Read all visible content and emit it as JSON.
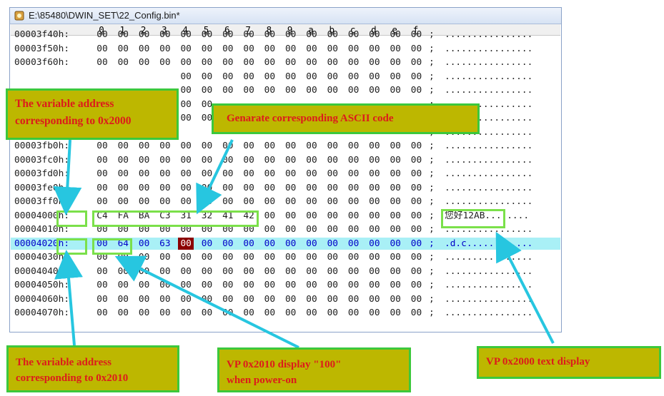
{
  "window": {
    "title": "E:\\85480\\DWIN_SET\\22_Config.bin*",
    "column_headers": [
      "0",
      "1",
      "2",
      "3",
      "4",
      "5",
      "6",
      "7",
      "8",
      "9",
      "a",
      "b",
      "c",
      "d",
      "e",
      "f"
    ]
  },
  "rows": [
    {
      "addr": "00003f40h:",
      "bytes": [
        "00",
        "00",
        "00",
        "00",
        "00",
        "00",
        "00",
        "00",
        "00",
        "00",
        "00",
        "00",
        "00",
        "00",
        "00",
        "00"
      ],
      "ascii": "................"
    },
    {
      "addr": "00003f50h:",
      "bytes": [
        "00",
        "00",
        "00",
        "00",
        "00",
        "00",
        "00",
        "00",
        "00",
        "00",
        "00",
        "00",
        "00",
        "00",
        "00",
        "00"
      ],
      "ascii": "................"
    },
    {
      "addr": "00003f60h:",
      "bytes": [
        "00",
        "00",
        "00",
        "00",
        "00",
        "00",
        "00",
        "00",
        "00",
        "00",
        "00",
        "00",
        "00",
        "00",
        "00",
        "00"
      ],
      "ascii": "................"
    },
    {
      "addr": "",
      "bytes": [
        "",
        "",
        "",
        "",
        "00",
        "00",
        "00",
        "00",
        "00",
        "00",
        "00",
        "00",
        "00",
        "00",
        "00",
        "00"
      ],
      "ascii": "................"
    },
    {
      "addr": "",
      "bytes": [
        "",
        "",
        "",
        "",
        "00",
        "00",
        "00",
        "00",
        "00",
        "00",
        "00",
        "00",
        "00",
        "00",
        "00",
        "00"
      ],
      "ascii": "................"
    },
    {
      "addr": "",
      "bytes": [
        "",
        "",
        "",
        "",
        "00",
        "00",
        "",
        "",
        "",
        "",
        "",
        "",
        "",
        "",
        "",
        ""
      ],
      "ascii": "................"
    },
    {
      "addr": "",
      "bytes": [
        "",
        "",
        "",
        "",
        "00",
        "00",
        "",
        "",
        "",
        "",
        "",
        "",
        "",
        "",
        "",
        ""
      ],
      "ascii": "................"
    },
    {
      "addr": "",
      "bytes": [
        "",
        "",
        "",
        "",
        "",
        "",
        "",
        "",
        "",
        "",
        "",
        "",
        "",
        "",
        "",
        ""
      ],
      "ascii": "................"
    },
    {
      "addr": "00003fb0h:",
      "bytes": [
        "00",
        "00",
        "00",
        "00",
        "00",
        "00",
        "00",
        "00",
        "00",
        "00",
        "00",
        "00",
        "00",
        "00",
        "00",
        "00"
      ],
      "ascii": "................"
    },
    {
      "addr": "00003fc0h:",
      "bytes": [
        "00",
        "00",
        "00",
        "00",
        "00",
        "00",
        "00",
        "00",
        "00",
        "00",
        "00",
        "00",
        "00",
        "00",
        "00",
        "00"
      ],
      "ascii": "................"
    },
    {
      "addr": "00003fd0h:",
      "bytes": [
        "00",
        "00",
        "00",
        "00",
        "00",
        "00",
        "00",
        "00",
        "00",
        "00",
        "00",
        "00",
        "00",
        "00",
        "00",
        "00"
      ],
      "ascii": "................"
    },
    {
      "addr": "00003fe0h:",
      "bytes": [
        "00",
        "00",
        "00",
        "00",
        "00",
        "00",
        "00",
        "00",
        "00",
        "00",
        "00",
        "00",
        "00",
        "00",
        "00",
        "00"
      ],
      "ascii": "................"
    },
    {
      "addr": "00003ff0h:",
      "bytes": [
        "00",
        "00",
        "00",
        "00",
        "00",
        "00",
        "00",
        "00",
        "00",
        "00",
        "00",
        "00",
        "00",
        "00",
        "00",
        "00"
      ],
      "ascii": "................"
    },
    {
      "addr": "00004000h:",
      "bytes": [
        "C4",
        "FA",
        "BA",
        "C3",
        "31",
        "32",
        "41",
        "42",
        "00",
        "00",
        "00",
        "00",
        "00",
        "00",
        "00",
        "00"
      ],
      "ascii": "您好12AB........"
    },
    {
      "addr": "00004010h:",
      "bytes": [
        "00",
        "00",
        "00",
        "00",
        "00",
        "00",
        "00",
        "00",
        "00",
        "00",
        "00",
        "00",
        "00",
        "00",
        "00",
        "00"
      ],
      "ascii": "................"
    },
    {
      "addr": "00004020h:",
      "bytes": [
        "00",
        "64",
        "00",
        "63",
        "00",
        "00",
        "00",
        "00",
        "00",
        "00",
        "00",
        "00",
        "00",
        "00",
        "00",
        "00"
      ],
      "ascii": ".d.c............",
      "highlight": true
    },
    {
      "addr": "00004030h:",
      "bytes": [
        "00",
        "00",
        "00",
        "00",
        "00",
        "00",
        "00",
        "00",
        "00",
        "00",
        "00",
        "00",
        "00",
        "00",
        "00",
        "00"
      ],
      "ascii": "................"
    },
    {
      "addr": "00004040h:",
      "bytes": [
        "00",
        "00",
        "00",
        "00",
        "00",
        "00",
        "00",
        "00",
        "00",
        "00",
        "00",
        "00",
        "00",
        "00",
        "00",
        "00"
      ],
      "ascii": "................"
    },
    {
      "addr": "00004050h:",
      "bytes": [
        "00",
        "00",
        "00",
        "00",
        "00",
        "00",
        "00",
        "00",
        "00",
        "00",
        "00",
        "00",
        "00",
        "00",
        "00",
        "00"
      ],
      "ascii": "................"
    },
    {
      "addr": "00004060h:",
      "bytes": [
        "00",
        "00",
        "00",
        "00",
        "00",
        "00",
        "00",
        "00",
        "00",
        "00",
        "00",
        "00",
        "00",
        "00",
        "00",
        "00"
      ],
      "ascii": "................"
    },
    {
      "addr": "00004070h:",
      "bytes": [
        "00",
        "00",
        "00",
        "00",
        "00",
        "00",
        "00",
        "00",
        "00",
        "00",
        "00",
        "00",
        "00",
        "00",
        "00",
        "00"
      ],
      "ascii": "................"
    }
  ],
  "annotations": {
    "addr_2000": "The variable address\ncorresponding to 0x2000",
    "ascii_code": "Genarate corresponding ASCII code",
    "addr_2010": "The variable address\ncorresponding to 0x2010",
    "vp_2010": "VP 0x2010 display \"100\"\nwhen power-on",
    "vp_2000": "VP 0x2000  text display"
  },
  "colors": {
    "annotation_bg": "#bdb700",
    "annotation_border": "#3cc83c",
    "annotation_text": "#dd1b1b",
    "arrow": "#27c6e0",
    "row_highlight": "#a9f0f6"
  }
}
